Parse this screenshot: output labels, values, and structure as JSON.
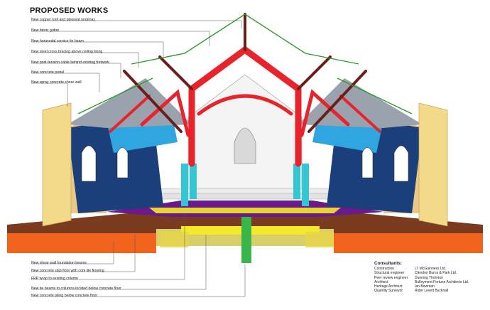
{
  "title": "PROPOSED WORKS",
  "labels_top": [
    "New copper roof and plywood underlay",
    "New fabric gutter",
    "New horizontal cornice tie beam",
    "New steel cross bracing above ceiling lining",
    "New post-tension cable behind existing fretwork",
    "New concrete portal",
    "New spray concrete shear wall"
  ],
  "labels_bottom": [
    "New shear wall foundation beams",
    "New concrete slab floor with cork tile flooring",
    "FRP wrap to existing column",
    "New tie beams to columns located below concrete floor",
    "New concrete piling below concrete floor"
  ],
  "consultants": {
    "title": "Consultants:",
    "rows": [
      {
        "role": "Construction",
        "firm": "LT McGuinness Ltd."
      },
      {
        "role": "Structural engineer",
        "firm": "Clendon Burns & Park Ltd."
      },
      {
        "role": "Peer review engineer",
        "firm": "Dunning Thornton"
      },
      {
        "role": "Architect",
        "firm": "Bulleyment Fortune Architects Ltd."
      },
      {
        "role": "Heritage Architect",
        "firm": "Ian Bowman"
      },
      {
        "role": "Quantity Surveyor",
        "firm": "Rider Levett Bucknall"
      }
    ]
  },
  "colors": {
    "red_portal": "#e8232b",
    "green_cable": "#2e9a2e",
    "blue_wall": "#1a3f7a",
    "cyan_column": "#35c6d6",
    "purple_floor": "#6a1a8a",
    "yellow_slab": "#f2ea2a",
    "orange_beam": "#f2641e",
    "tan_wall": "#e8c98a"
  }
}
